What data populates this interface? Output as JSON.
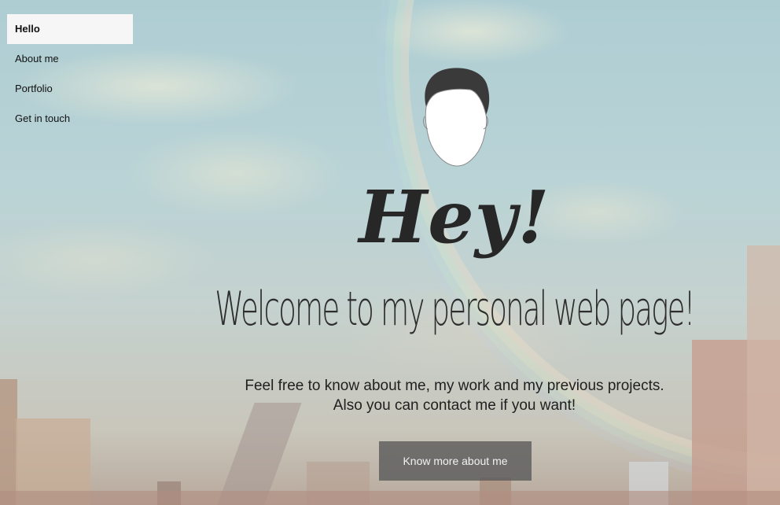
{
  "nav": {
    "items": [
      {
        "label": "Hello",
        "active": true
      },
      {
        "label": "About me",
        "active": false
      },
      {
        "label": "Portfolio",
        "active": false
      },
      {
        "label": "Get in touch",
        "active": false
      }
    ]
  },
  "hero": {
    "avatar_icon": "face-avatar-icon",
    "greeting": "Hey!",
    "headline": "Welcome to my personal web page!",
    "intro_line1": "Feel free to know about me, my work and my previous projects.",
    "intro_line2": "Also you can contact me if you want!",
    "cta_label": "Know more about me"
  },
  "colors": {
    "text": "#272727",
    "nav_active_bg": "#f6f6f6",
    "cta_bg": "#5a5a5a"
  }
}
